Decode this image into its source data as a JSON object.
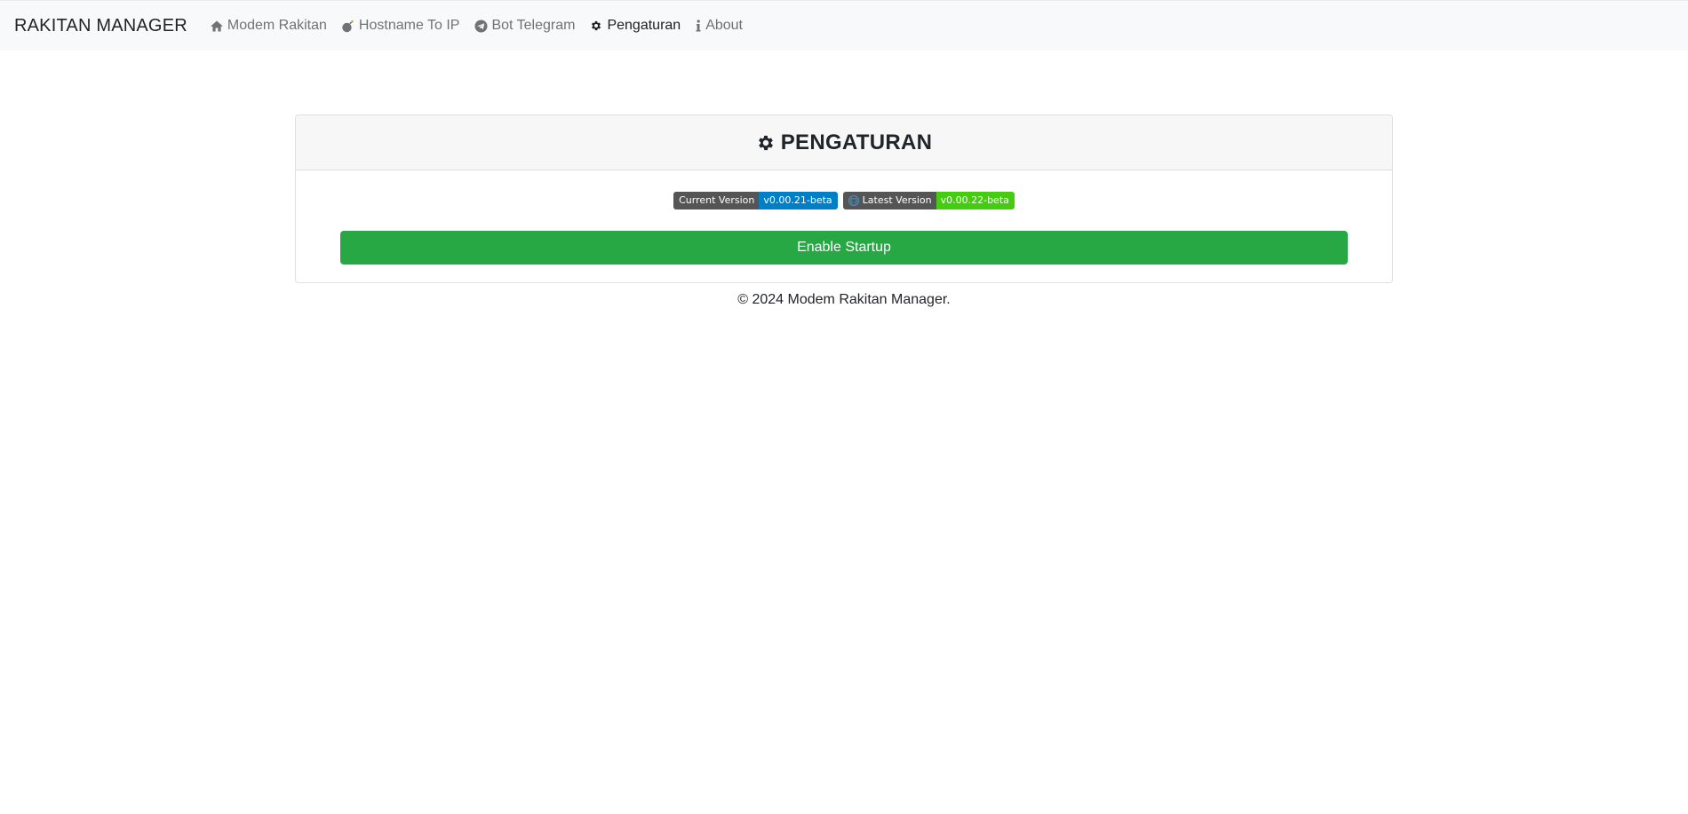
{
  "navbar": {
    "brand": "RAKITAN MANAGER",
    "items": [
      {
        "label": "Modem Rakitan",
        "icon": "home-icon",
        "active": false
      },
      {
        "label": "Hostname To IP",
        "icon": "bomb-icon",
        "active": false
      },
      {
        "label": "Bot Telegram",
        "icon": "telegram-icon",
        "active": false
      },
      {
        "label": "Pengaturan",
        "icon": "gear-icon",
        "active": true
      },
      {
        "label": "About",
        "icon": "info-icon",
        "active": false
      }
    ]
  },
  "card": {
    "title": "PENGATURAN",
    "title_icon": "gear-icon",
    "badges": [
      {
        "label": "Current Version",
        "value": "v0.00.21-beta",
        "color": "#007ec6"
      },
      {
        "label": "Latest Version",
        "value": "v0.00.22-beta",
        "color": "#44cc11",
        "icon": "github-icon"
      }
    ],
    "startup_button": "Enable Startup",
    "startup_button_color": "#28a745"
  },
  "footer": {
    "text": "© 2024 Modem Rakitan Manager."
  }
}
